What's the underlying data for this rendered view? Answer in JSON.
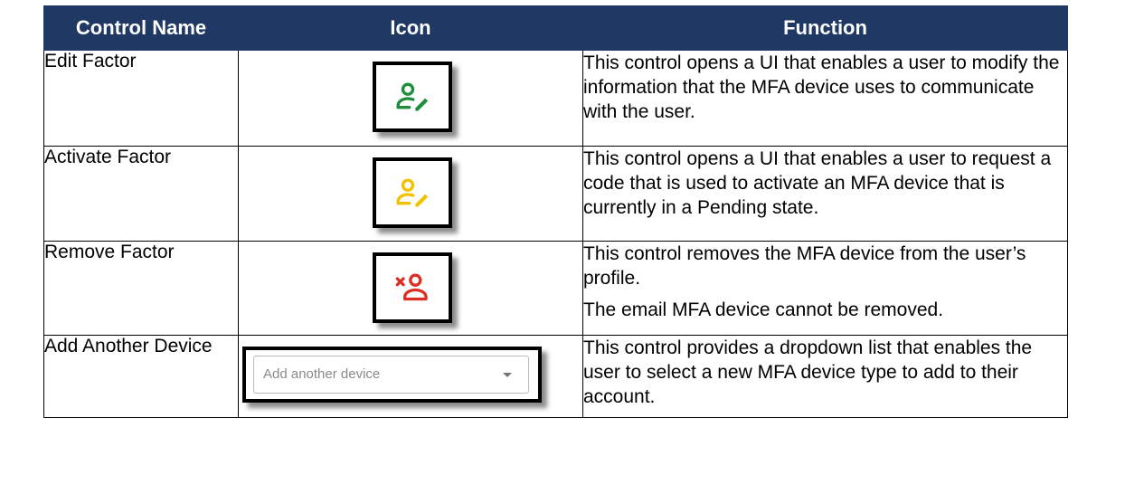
{
  "headers": {
    "control_name": "Control Name",
    "icon": "Icon",
    "function": "Function"
  },
  "rows": [
    {
      "name": "Edit Factor",
      "icon": "user-edit-icon",
      "icon_color": "#1e8e3e",
      "function": [
        "This control opens a UI that enables a user to modify the information that the MFA device uses to communicate with the user."
      ]
    },
    {
      "name": "Activate Factor",
      "icon": "user-edit-icon",
      "icon_color": "#f2c200",
      "function": [
        "This control opens a UI that enables a user to request a code that is used to activate an MFA device that is currently in a Pending state."
      ]
    },
    {
      "name": "Remove Factor",
      "icon": "user-remove-icon",
      "icon_color": "#d93025",
      "function": [
        "This control removes the MFA device from the user’s profile.",
        "The email MFA device cannot be removed."
      ]
    },
    {
      "name": "Add Another Device",
      "icon": "dropdown",
      "dropdown_placeholder": "Add another device",
      "function": [
        "This control provides a dropdown list that enables the user to select a new MFA device type to add to their account."
      ]
    }
  ],
  "colors": {
    "header_bg": "#1f3864",
    "header_text": "#ffffff"
  }
}
